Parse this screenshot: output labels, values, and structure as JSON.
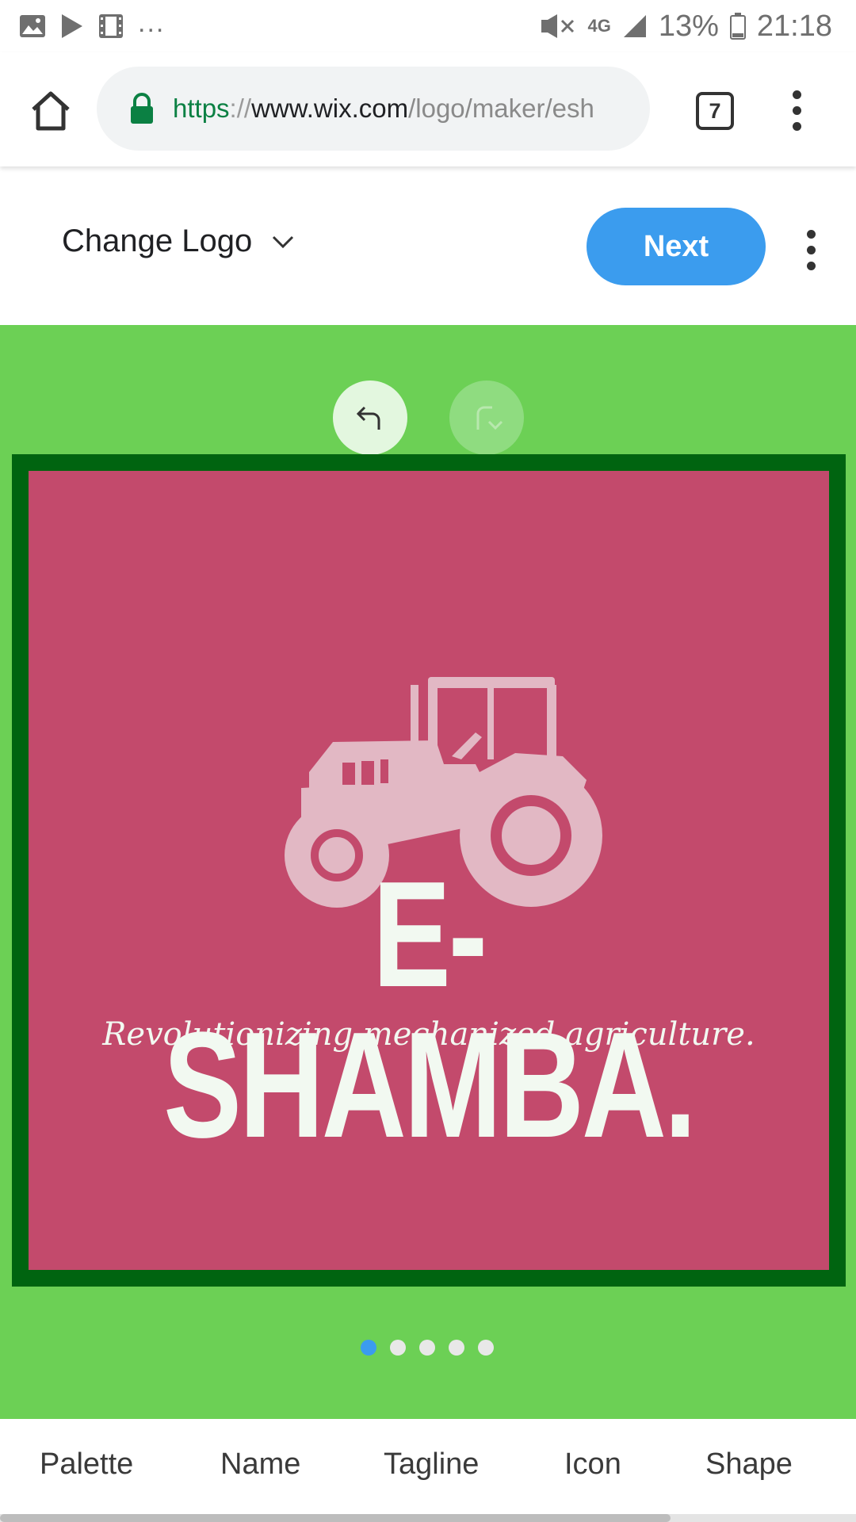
{
  "status_bar": {
    "overflow": "...",
    "network": "4G",
    "battery": "13%",
    "time": "21:18",
    "icons": [
      "image-icon",
      "play-icon",
      "video-icon",
      "mute-icon",
      "signal-icon",
      "battery-icon"
    ]
  },
  "browser": {
    "url_scheme": "https",
    "url_separator": "://",
    "url_host": "www.wix.com",
    "url_path": "/logo/maker/esh",
    "tab_count": "7"
  },
  "header": {
    "change_logo_label": "Change Logo",
    "next_label": "Next"
  },
  "logo": {
    "name": "E-SHAMBA.",
    "tagline": "Revolutionizing mechanized agriculture.",
    "icon": "tractor-icon",
    "background_color": "#c34a6c",
    "border_color": "#006410",
    "text_color": "#f2f9f1"
  },
  "canvas": {
    "background_color": "#6cd055",
    "pager": {
      "count": 5,
      "current": 1
    }
  },
  "bottom_tabs": [
    "Palette",
    "Name",
    "Tagline",
    "Icon",
    "Shape"
  ],
  "colors": {
    "accent": "#3b9cee",
    "secure": "#0b8043"
  }
}
